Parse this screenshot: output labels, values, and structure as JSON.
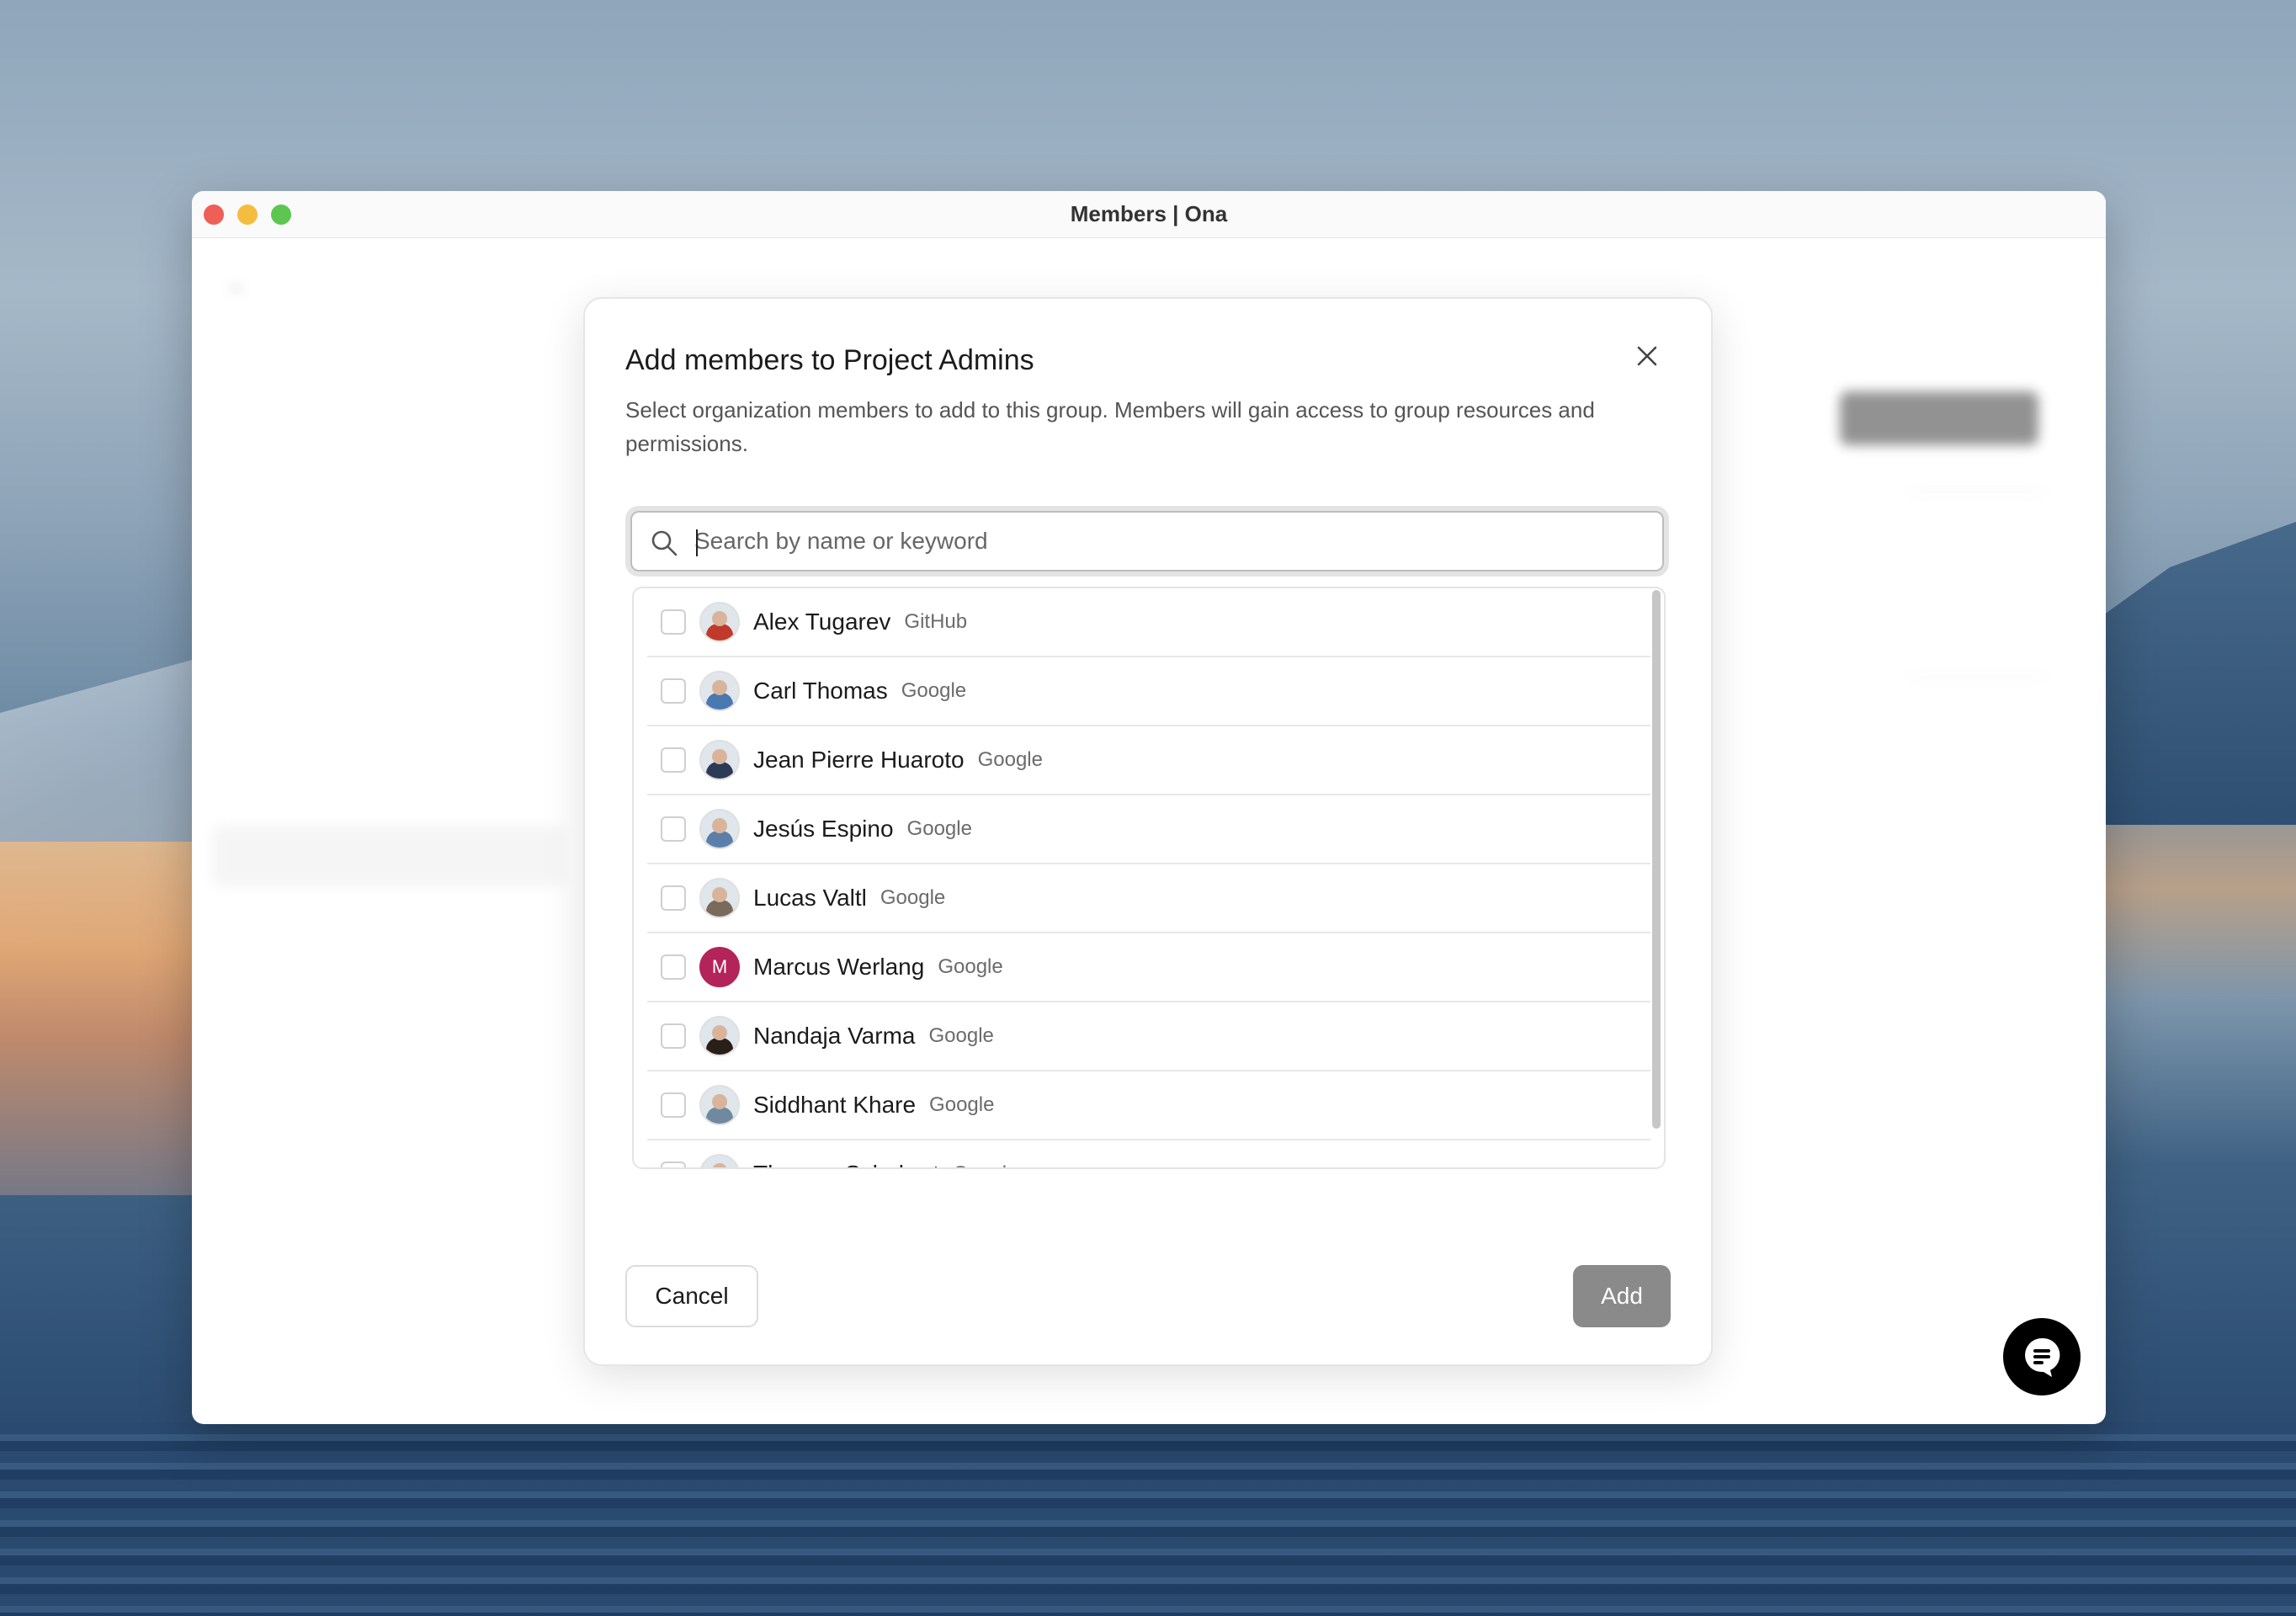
{
  "window": {
    "title": "Members | Ona"
  },
  "modal": {
    "title": "Add members to Project Admins",
    "description": "Select organization members to add to this group. Members will gain access to group resources and permissions.",
    "search": {
      "placeholder": "Search by name or keyword",
      "value": ""
    },
    "members": [
      {
        "name": "Alex Tugarev",
        "provider": "GitHub",
        "checked": false,
        "avatar_color": "#c0392b"
      },
      {
        "name": "Carl Thomas",
        "provider": "Google",
        "checked": false,
        "avatar_color": "#4a78b0"
      },
      {
        "name": "Jean Pierre Huaroto",
        "provider": "Google",
        "checked": false,
        "avatar_color": "#2b3a55"
      },
      {
        "name": "Jesús Espino",
        "provider": "Google",
        "checked": false,
        "avatar_color": "#5b7fa8"
      },
      {
        "name": "Lucas Valtl",
        "provider": "Google",
        "checked": false,
        "avatar_color": "#7a6a5a"
      },
      {
        "name": "Marcus Werlang",
        "provider": "Google",
        "checked": false,
        "avatar_letter": "M",
        "avatar_color": "#b3245a"
      },
      {
        "name": "Nandaja Varma",
        "provider": "Google",
        "checked": false,
        "avatar_color": "#2a1e18"
      },
      {
        "name": "Siddhant Khare",
        "provider": "Google",
        "checked": false,
        "avatar_color": "#6f8aa0"
      },
      {
        "name": "Thomas Schubart",
        "provider": "Google",
        "checked": false,
        "avatar_color": "#333333"
      }
    ],
    "buttons": {
      "cancel": "Cancel",
      "add": "Add"
    }
  },
  "icons": {
    "close": "close-icon",
    "search": "search-icon",
    "chat": "chat-icon"
  },
  "colors": {
    "add_button_disabled": "#8a8a8a",
    "chat_button": "#000000"
  }
}
